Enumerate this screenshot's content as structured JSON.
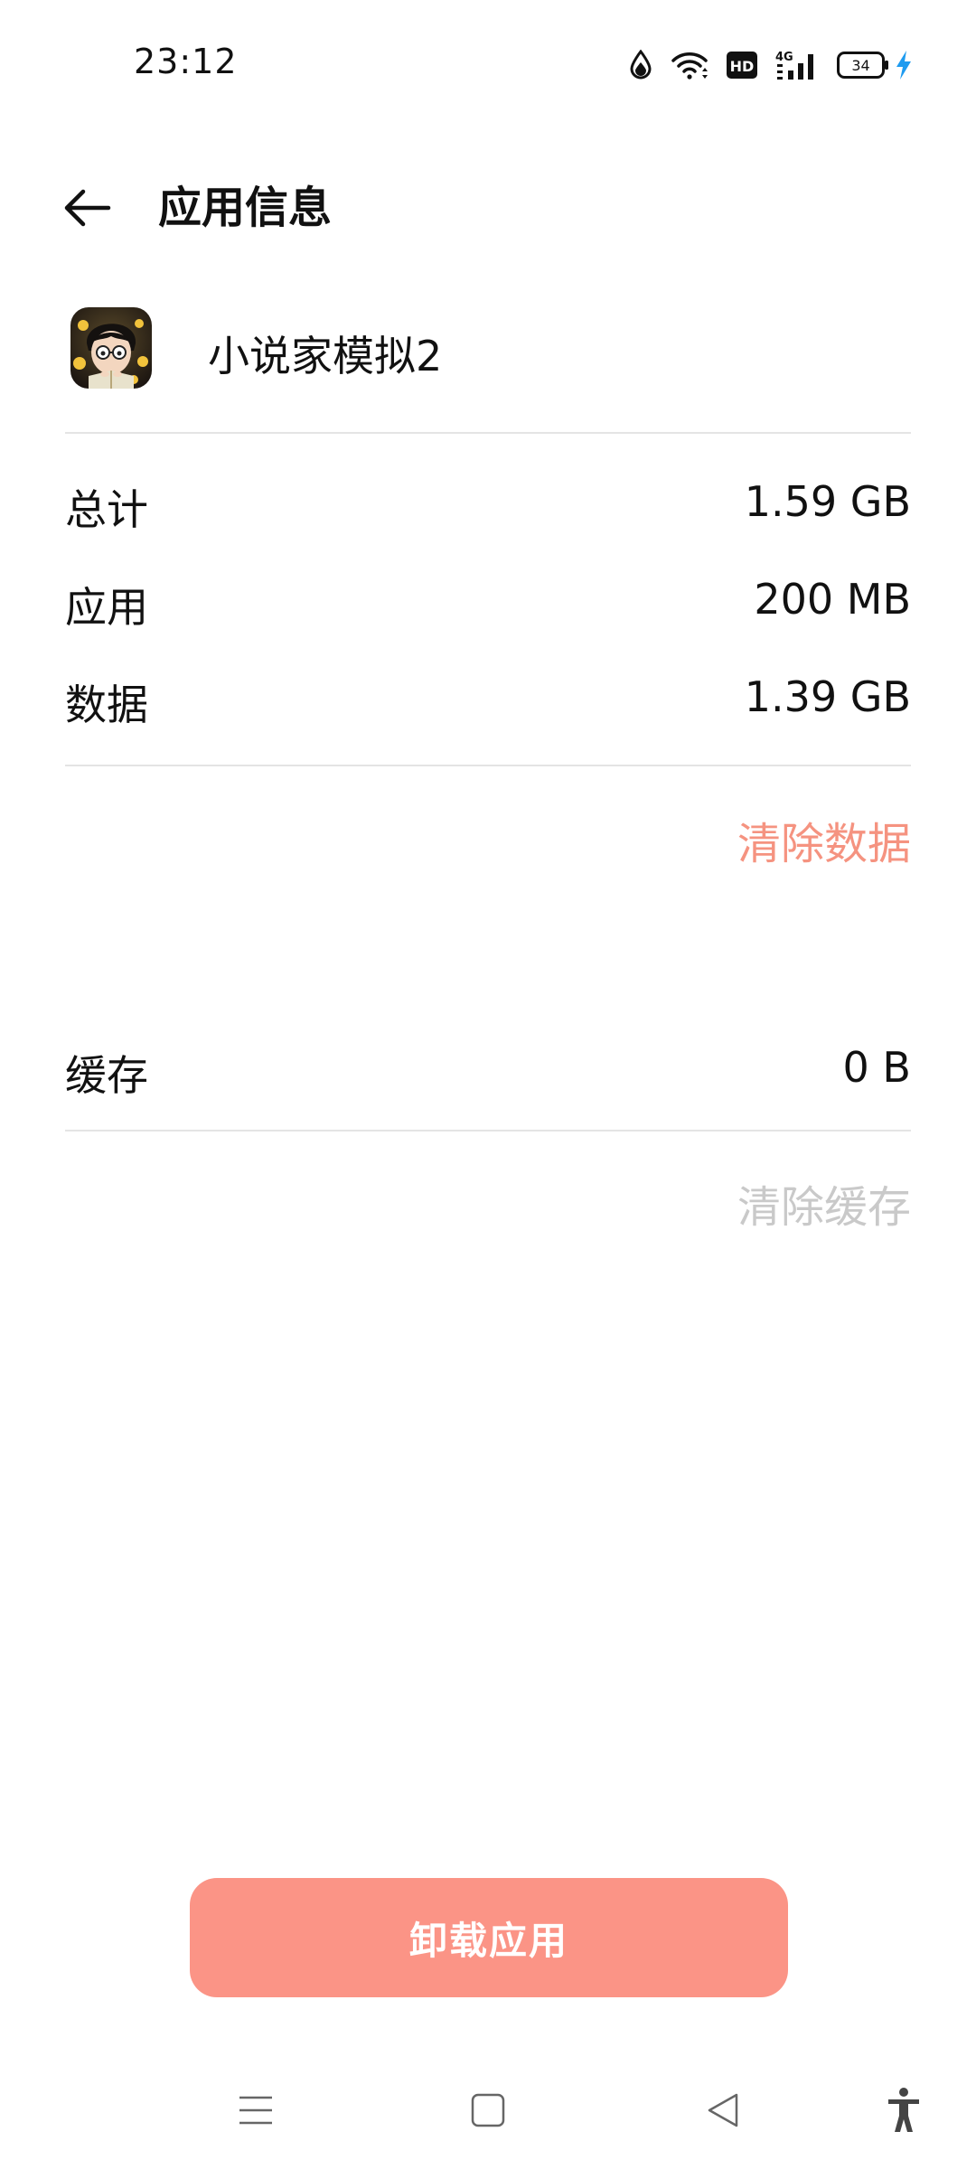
{
  "status_bar": {
    "time": "23:12",
    "icons": [
      "data-saver-icon",
      "wifi-icon",
      "hd-icon",
      "signal-4g-icon",
      "battery-icon",
      "charging-icon"
    ],
    "hd_label": "HD",
    "network_label": "4G",
    "battery_level": "34",
    "charging_color": "#1e9bf0"
  },
  "header": {
    "title": "应用信息"
  },
  "app": {
    "name": "小说家模拟2"
  },
  "storage": {
    "rows": [
      {
        "label": "总计",
        "value": "1.59 GB"
      },
      {
        "label": "应用",
        "value": "200 MB"
      },
      {
        "label": "数据",
        "value": "1.39 GB"
      }
    ],
    "clear_data_label": "清除数据",
    "cache_label": "缓存",
    "cache_value": "0 B",
    "clear_cache_label": "清除缓存"
  },
  "uninstall_label": "卸载应用",
  "colors": {
    "accent": "#f59380",
    "uninstall_bg": "#fb9486",
    "disabled_text": "#c9c9c9",
    "divider": "#e4e4e4"
  },
  "nav_bar": {
    "icons": [
      "menu-icon",
      "home-icon",
      "back-triangle-icon",
      "accessibility-icon"
    ]
  }
}
